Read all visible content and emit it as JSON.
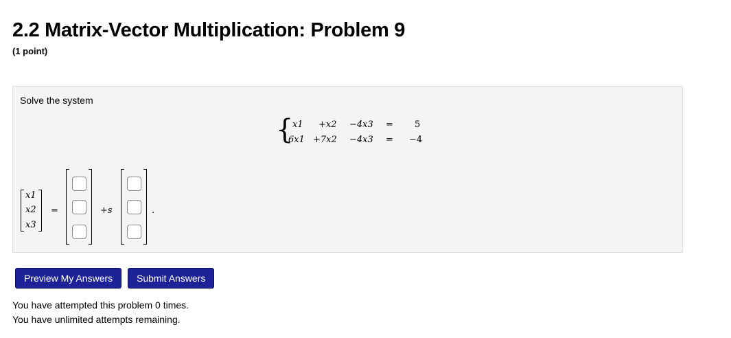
{
  "problem": {
    "title": "2.2 Matrix-Vector Multiplication: Problem 9",
    "points": "(1 point)"
  },
  "panel": {
    "instruction": "Solve the system",
    "system": {
      "rows": [
        {
          "c1": "x1",
          "c2": "+x2",
          "c3": "−4x3",
          "eq": "=",
          "rhs": "5"
        },
        {
          "c1": "6x1",
          "c2": "+7x2",
          "c3": "−4x3",
          "eq": "=",
          "rhs": "−4"
        }
      ]
    },
    "solution": {
      "vector": [
        "x1",
        "x2",
        "x3"
      ],
      "equals": "=",
      "plus_s": "+s",
      "period": "."
    }
  },
  "buttons": {
    "preview": "Preview My Answers",
    "submit": "Submit Answers"
  },
  "status": {
    "attempts": "You have attempted this problem 0 times.",
    "remaining": "You have unlimited attempts remaining."
  }
}
